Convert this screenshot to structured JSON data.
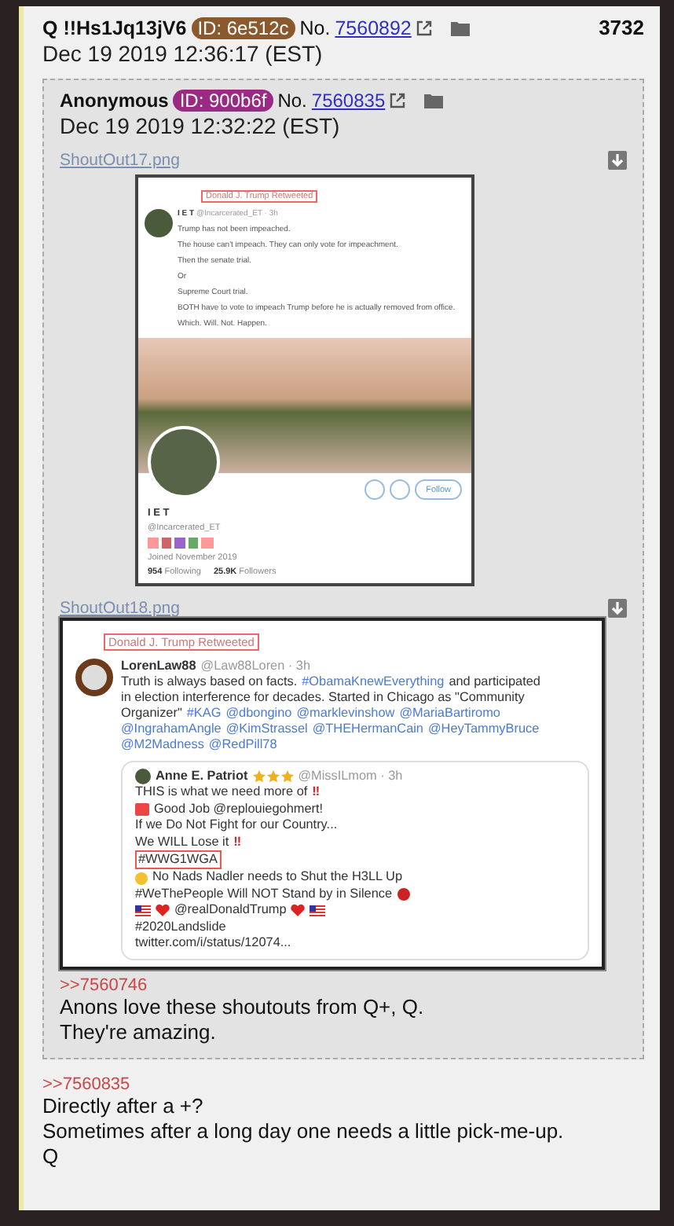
{
  "post": {
    "name": "Q !!Hs1Jq13jV6",
    "id": "ID: 6e512c",
    "color": "#8a5a2e",
    "no_label": "No.",
    "number": "7560892",
    "date": "Dec 19 2019 12:36:17 (EST)",
    "count": "3732"
  },
  "quoted_post": {
    "name": "Anonymous",
    "id": "ID: 900b6f",
    "color": "#9a2a84",
    "no_label": "No.",
    "number": "7560835",
    "date": "Dec 19 2019 12:32:22 (EST)",
    "files": [
      {
        "kind": "profile",
        "filename": "ShoutOut17.png",
        "retweet_label": "Donald J. Trump Retweeted",
        "author": "I E T",
        "handle": "@Incarcerated_ET · 3h",
        "paragraphs": [
          "Trump has not been impeached.",
          "The house can't impeach. They can only vote for impeachment.",
          "Then the senate trial.",
          "Or",
          "Supreme Court trial.",
          "BOTH have to vote to impeach Trump before he is actually removed from office.",
          "Which. Will. Not. Happen."
        ],
        "profile": {
          "name": "I E T",
          "handle": "@Incarcerated_ET",
          "follow": "Follow",
          "joined": "Joined November 2019",
          "following_count": "954",
          "following_label": "Following",
          "followers_count": "25.9K",
          "followers_label": "Followers"
        }
      },
      {
        "kind": "quote",
        "filename": "ShoutOut18.png",
        "retweet_label": "Donald J. Trump Retweeted",
        "author": "LorenLaw88",
        "handle": "@Law88Loren · 3h",
        "lines": [
          [
            {
              "kind": "text",
              "text": "Truth is always based on facts."
            },
            {
              "kind": "hashtag",
              "text": "#ObamaKnewEverything"
            },
            {
              "kind": "text",
              "text": " and participated"
            }
          ],
          [
            {
              "kind": "text",
              "text": "in election interference for decades. Started in Chicago as \"Community"
            }
          ],
          [
            {
              "kind": "text",
              "text": "Organizer\""
            },
            {
              "kind": "hashtag",
              "text": "#KAG"
            },
            {
              "kind": "mention",
              "text": "@dbongino"
            },
            {
              "kind": "mention",
              "text": "@marklevinshow"
            },
            {
              "kind": "mention",
              "text": "@MariaBartiromo"
            }
          ],
          [
            {
              "kind": "mention",
              "text": "@IngrahamAngle"
            },
            {
              "kind": "mention",
              "text": "@KimStrassel"
            },
            {
              "kind": "mention",
              "text": "@THEHermanCain"
            },
            {
              "kind": "mention",
              "text": "@HeyTammyBruce"
            }
          ],
          [
            {
              "kind": "mention",
              "text": "@M2Madness"
            },
            {
              "kind": "mention",
              "text": "@RedPill78"
            }
          ]
        ],
        "quoted": {
          "author": "Anne E. Patriot",
          "stars": 3,
          "handle": "@MissILmom · 3h",
          "lines": [
            [
              {
                "kind": "text",
                "text": "THIS is what we need more of"
              },
              {
                "kind": "emphasis",
                "text": "‼"
              }
            ],
            [
              {
                "kind": "hundred"
              },
              {
                "kind": "text",
                "text": "Good Job @replouiegohmert!"
              }
            ],
            [
              {
                "kind": "text",
                "text": "If we Do Not Fight for our Country..."
              }
            ],
            [
              {
                "kind": "text",
                "text": "We WILL Lose it"
              },
              {
                "kind": "emphasis",
                "text": "‼"
              }
            ],
            [
              {
                "kind": "boxed",
                "text": "#WWG1WGA"
              }
            ],
            [
              {
                "kind": "smiley"
              },
              {
                "kind": "text",
                "text": "No Nads Nadler needs to Shut the H3LL Up"
              }
            ],
            [
              {
                "kind": "text",
                "text": "#WeThePeople Will NOT Stand by in Silence"
              },
              {
                "kind": "angry"
              }
            ],
            [
              {
                "kind": "flag"
              },
              {
                "kind": "heart"
              },
              {
                "kind": "text",
                "text": "@realDonaldTrump"
              },
              {
                "kind": "heart"
              },
              {
                "kind": "flag"
              }
            ],
            [
              {
                "kind": "text",
                "text": "#2020Landslide"
              }
            ],
            [
              {
                "kind": "text",
                "text": "twitter.com/i/status/12074..."
              }
            ]
          ]
        }
      }
    ],
    "reply_link": ">>7560746",
    "body": [
      "Anons love these shoutouts from Q+, Q.",
      "They're amazing."
    ]
  },
  "reply_link": ">>7560835",
  "body": [
    "Directly after a +?",
    "Sometimes after a long day one needs a little pick-me-up.",
    "Q"
  ]
}
